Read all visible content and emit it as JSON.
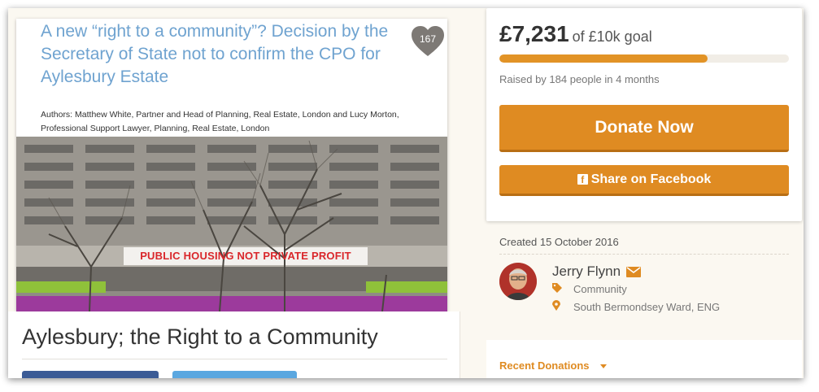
{
  "campaign": {
    "title": "Aylesbury; the Right to a Community",
    "image": {
      "article_title": "A new “right to a community”? Decision by the Secretary of State not to confirm the CPO for Aylesbury Estate",
      "authors": "Authors: Matthew White, Partner and Head of Planning, Real Estate, London and Lucy Morton, Professional Support Lawyer, Planning, Real Estate, London",
      "banner": "PUBLIC HOUSING NOT PRIVATE PROFIT",
      "likes": "167"
    }
  },
  "donation": {
    "amount": "£7,231",
    "goal": "of £10k goal",
    "progress": 0.72,
    "raised_by": "Raised by 184 people in 4 months",
    "donate_label": "Donate Now",
    "facebook_label": "Share on Facebook",
    "facebook_icon_glyph": "f"
  },
  "organiser": {
    "created": "Created 15 October 2016",
    "name": "Jerry Flynn",
    "category": "Community",
    "location": "South Bermondsey Ward, ENG",
    "icons": [
      "envelope-icon",
      "tag-icon",
      "map-marker-icon"
    ]
  },
  "recent": {
    "label": "Recent Donations"
  },
  "colors": {
    "accent": "#df8b22",
    "link": "#6fa3d0",
    "facebook": "#3b5b96",
    "twitter": "#5aa7e0"
  }
}
